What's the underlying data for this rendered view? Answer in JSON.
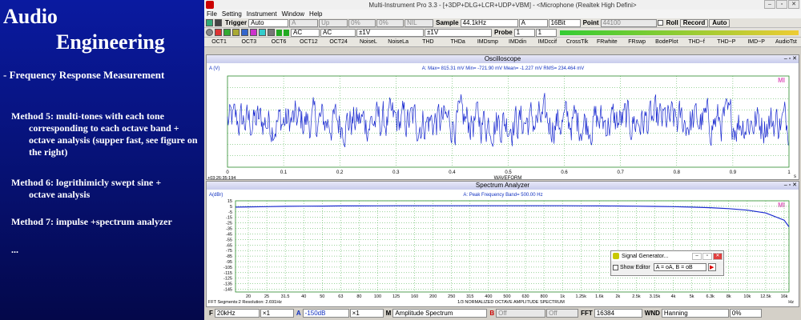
{
  "slide": {
    "title_line1": "Audio",
    "title_line2": "Engineering",
    "subtitle": "- Frequency Response Measurement",
    "method5_a": "Method 5: multi-tones with each tone",
    "method5_b": "corresponding to each octave band + octave analysis (supper fast, see figure on the right)",
    "method6_a": "Method 6: logrithimicly swept sine +",
    "method6_b": "octave analysis",
    "method7": "Method 7: impulse +spectrum analyzer",
    "ellipsis": "..."
  },
  "window": {
    "title": "Multi-Instrument Pro 3.3   -   [+3DP+DLG+LCR+UDP+VBM]   -   <Microphone (Realtek High Defini>"
  },
  "menu": [
    "File",
    "Setting",
    "Instrument",
    "Window",
    "Help"
  ],
  "toolbar1": {
    "trigger_label": "Trigger",
    "trigger_mode": "Auto",
    "channel": "A",
    "edge": "Up",
    "level1": "0%",
    "level2": "0%",
    "nil": "NIL",
    "sample_label": "Sample",
    "sample_rate": "44.1kHz",
    "ch_select": "A",
    "bits": "16Bit",
    "point_label": "Point",
    "points": "44100",
    "roll_label": "Roll",
    "record_label": "Record",
    "auto_label": "Auto"
  },
  "toolbar2": {
    "coupling_a": "AC",
    "coupling_b": "AC",
    "range_a": "±1V",
    "range_b": "±1V",
    "probe_label": "Probe",
    "probe_a": "1",
    "probe_b": "1"
  },
  "tabs": [
    "OCT1",
    "OCT3",
    "OCT6",
    "OCT12",
    "OCT24",
    "NoiseL",
    "NoiseLa",
    "THD",
    "THDa",
    "IMDsmp",
    "IMDdin",
    "IMDccif",
    "CrossTlk",
    "FRwhite",
    "FRswp",
    "BodePlot",
    "THD~f",
    "THD~P",
    "IMD~P",
    "AudioTst"
  ],
  "oscilloscope": {
    "title": "Oscilloscope",
    "unit_label": "A (V)",
    "measurements": "A: Max=   815.31 mV  Min=   -721.90 mV  Mean=    -1.227 mV  RMS=   234.464 mV",
    "timestamp": "+03:26:35:194",
    "xlabel": "WAVEFORM",
    "xunit": "s",
    "mi": "MI"
  },
  "spectrum": {
    "title": "Spectrum Analyzer",
    "unit_label": "A(dBr)",
    "peak": "A: Peak Frequency Band=    500.00    Hz",
    "footer_left": "FFT  Segments:2    Resolution: 2.691Hz",
    "xlabel": "1/3 NORMALIZED OCTAVE AMPLITUDE SPECTRUM",
    "xunit": "Hz",
    "mi": "MI"
  },
  "siggen": {
    "title": "Signal Generator...",
    "show_editor": "Show Editor",
    "expression": "A = oA, B = oB"
  },
  "bottom": {
    "f_label": "F",
    "f_value": "20kHz",
    "x1": "×1",
    "a_label": "A",
    "a_value": "-150dB",
    "x2": "×1",
    "m_label": "M",
    "m_value": "Amplitude Spectrum",
    "b_label": "B",
    "b_value": "Off",
    "off2": "Off",
    "fft_label": "FFT",
    "fft_value": "16384",
    "wnd_label": "WND",
    "wnd_value": "Hanning",
    "pct": "0%"
  },
  "chart_data": [
    {
      "type": "line",
      "title": "Oscilloscope",
      "xlabel": "WAVEFORM",
      "ylabel": "A (V)",
      "x_ticks": [
        "0",
        "0.1",
        "0.2",
        "0.3",
        "0.4",
        "0.5",
        "0.6",
        "0.7",
        "0.8",
        "0.9",
        "1"
      ],
      "xlim": [
        0,
        1
      ],
      "ylim": [
        -1,
        1
      ],
      "grid": true,
      "series": [
        {
          "min": -0.7219,
          "max": 0.81531,
          "rms": 0.234464
        }
      ]
    },
    {
      "type": "line",
      "title": "Spectrum Analyzer",
      "xlabel": "1/3 NORMALIZED OCTAVE AMPLITUDE SPECTRUM",
      "ylabel": "A(dBr)",
      "categories": [
        "20",
        "25",
        "31.5",
        "40",
        "50",
        "63",
        "80",
        "100",
        "125",
        "160",
        "200",
        "250",
        "315",
        "400",
        "500",
        "630",
        "800",
        "1k",
        "1.25k",
        "1.6k",
        "2k",
        "2.5k",
        "3.15k",
        "4k",
        "5k",
        "6.3k",
        "8k",
        "10k",
        "12.5k",
        "16k"
      ],
      "y_ticks": [
        "15",
        "5",
        "-5",
        "-15",
        "-25",
        "-35",
        "-45",
        "-55",
        "-65",
        "-75",
        "-85",
        "-95",
        "-105",
        "-115",
        "-125",
        "-135",
        "-145"
      ],
      "ylim": [
        -150,
        15
      ],
      "grid": true,
      "series": [
        {
          "values": [
            4,
            4.5,
            5,
            5.3,
            5.5,
            5.7,
            5.8,
            5.9,
            6,
            6,
            6,
            6,
            6,
            6,
            6,
            6,
            6,
            6,
            5.9,
            5.8,
            5.6,
            5.3,
            4.9,
            4.4,
            3.6,
            2.5,
            0.8,
            -2,
            -7,
            -20
          ]
        }
      ]
    }
  ]
}
